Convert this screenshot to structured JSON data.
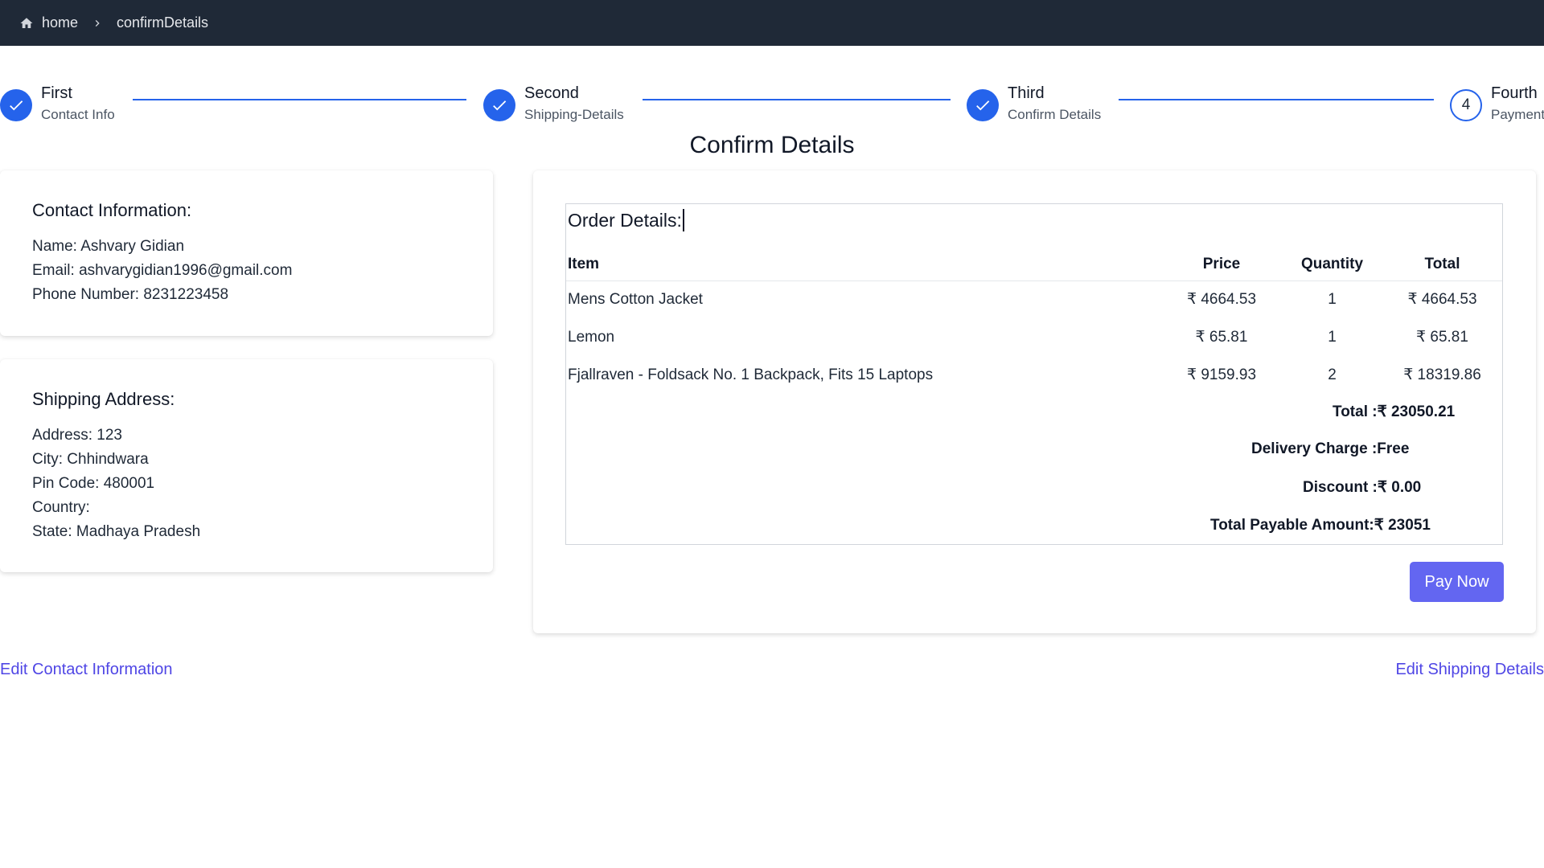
{
  "breadcrumb": {
    "home": "home",
    "current": "confirmDetails"
  },
  "stepper": [
    {
      "title": "First",
      "subtitle": "Contact Info",
      "status": "done"
    },
    {
      "title": "Second",
      "subtitle": "Shipping-Details",
      "status": "done"
    },
    {
      "title": "Third",
      "subtitle": "Confirm Details",
      "status": "done"
    },
    {
      "title": "Fourth",
      "subtitle": "Payment",
      "status": "pending",
      "number": "4"
    }
  ],
  "page_title": "Confirm Details",
  "contact": {
    "heading": "Contact Information:",
    "name": "Name: Ashvary Gidian",
    "email": "Email: ashvarygidian1996@gmail.com",
    "phone": "Phone Number: 8231223458"
  },
  "shipping": {
    "heading": "Shipping Address:",
    "address": "Address: 123",
    "city": "City: Chhindwara",
    "pin": "Pin Code: 480001",
    "country": "Country:",
    "state": "State: Madhaya Pradesh"
  },
  "order": {
    "heading": "Order Details:",
    "columns": {
      "item": "Item",
      "price": "Price",
      "quantity": "Quantity",
      "total": "Total"
    },
    "rows": [
      {
        "item": "Mens Cotton Jacket",
        "price": "₹ 4664.53",
        "quantity": "1",
        "total": "₹ 4664.53"
      },
      {
        "item": "Lemon",
        "price": "₹ 65.81",
        "quantity": "1",
        "total": "₹ 65.81"
      },
      {
        "item": "Fjallraven - Foldsack No. 1 Backpack, Fits 15 Laptops",
        "price": "₹ 9159.93",
        "quantity": "2",
        "total": "₹ 18319.86"
      }
    ],
    "summary": {
      "total_label": "Total :",
      "total_value": "₹ 23050.21",
      "delivery_label": "Delivery Charge :",
      "delivery_value": "Free",
      "discount_label": "Discount :",
      "discount_value": "₹ 0.00",
      "payable_label": "Total Payable Amount:",
      "payable_value": "₹ 23051"
    },
    "pay_button": "Pay Now"
  },
  "links": {
    "edit_contact": "Edit Contact Information",
    "edit_shipping": "Edit Shipping Details"
  },
  "colors": {
    "topbar": "#1f2937",
    "accent": "#2563eb",
    "button": "#6366f1",
    "link": "#4f46e5"
  }
}
